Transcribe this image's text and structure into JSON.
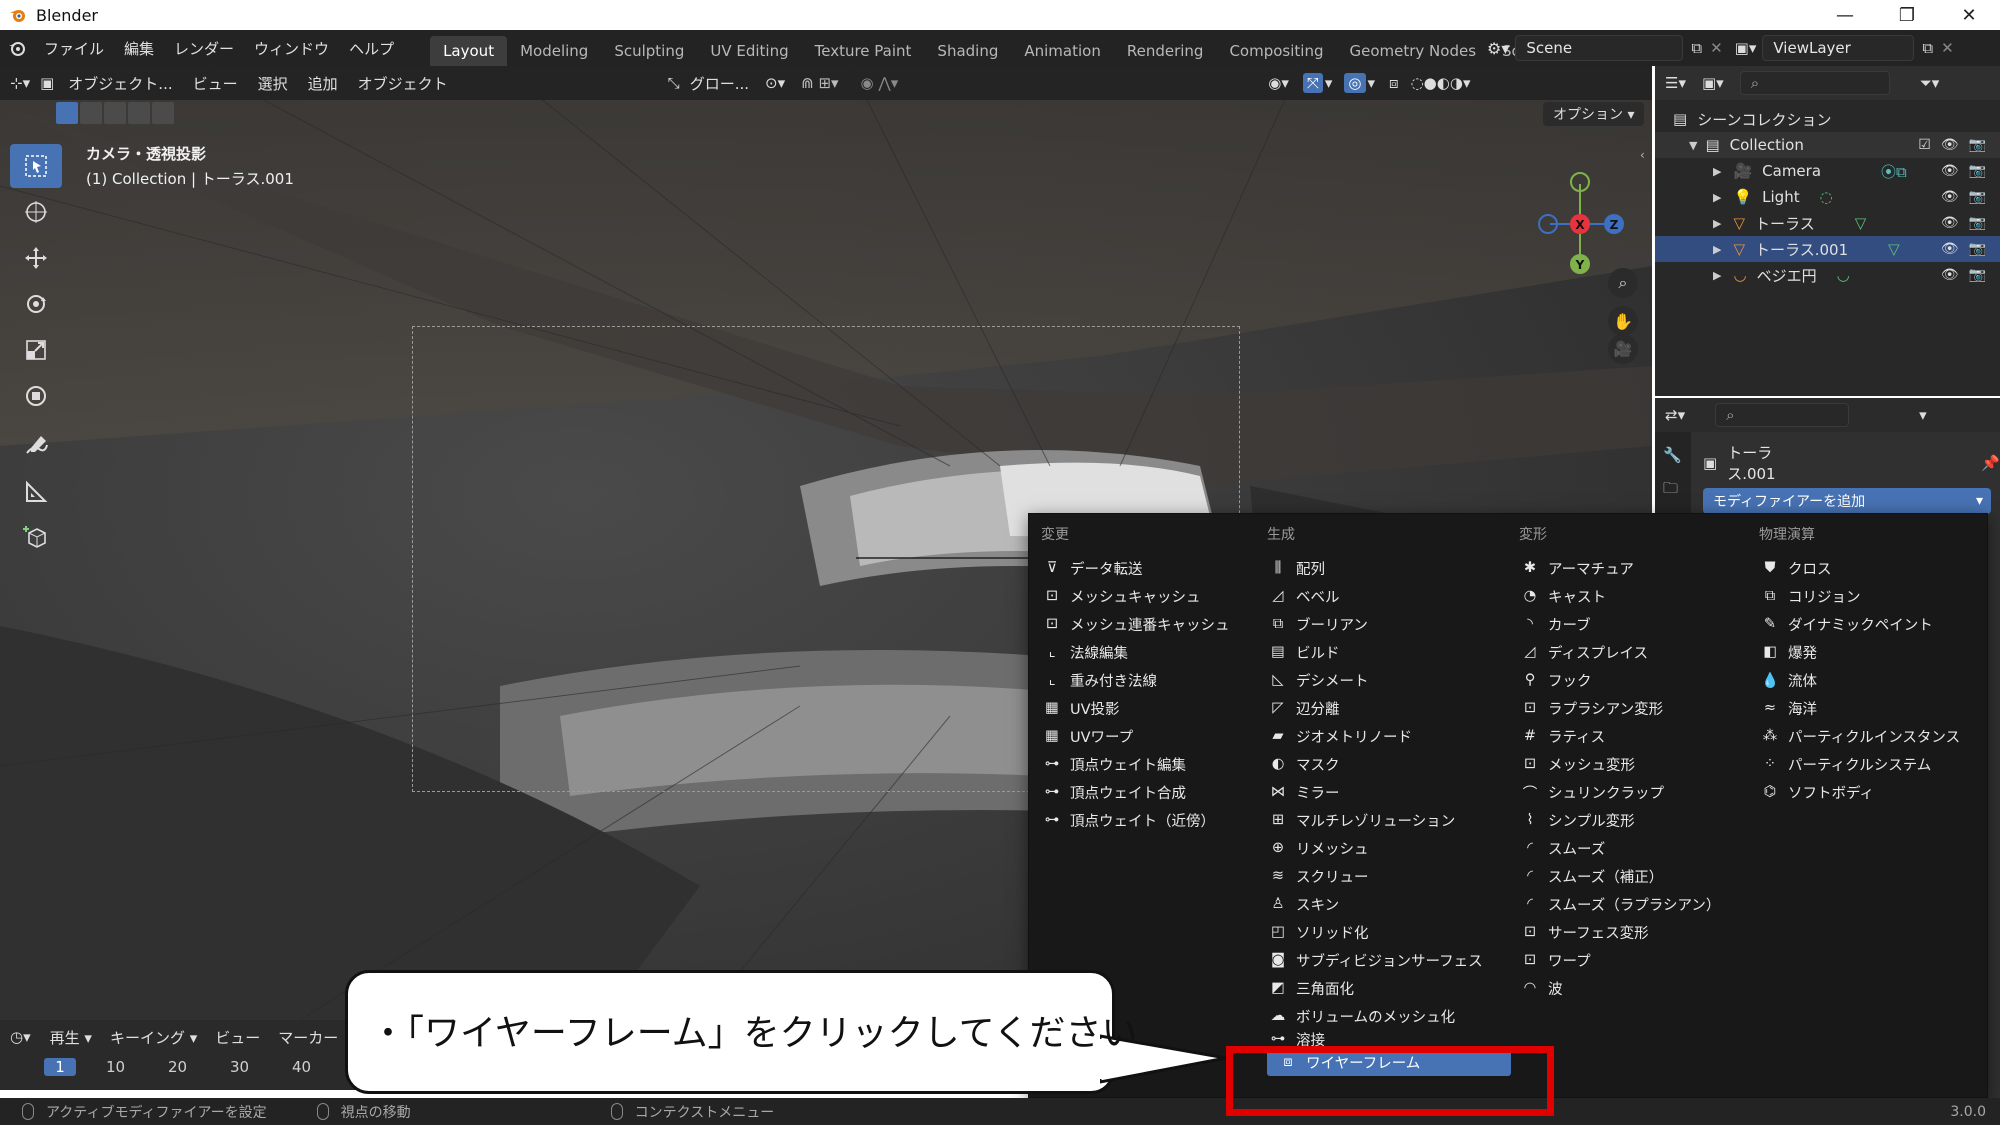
{
  "window": {
    "title": "Blender",
    "minimize": "—",
    "maximize": "❐",
    "close": "✕"
  },
  "menu": {
    "items": [
      "ファイル",
      "編集",
      "レンダー",
      "ウィンドウ",
      "ヘルプ"
    ]
  },
  "workspaces": {
    "tabs": [
      "Layout",
      "Modeling",
      "Sculpting",
      "UV Editing",
      "Texture Paint",
      "Shading",
      "Animation",
      "Rendering",
      "Compositing",
      "Geometry Nodes",
      "Scripting"
    ],
    "active": "Layout",
    "add": "+"
  },
  "scene": {
    "name": "Scene",
    "view_layer": "ViewLayer"
  },
  "viewport": {
    "header_items": [
      "オブジェクト...",
      "ビュー",
      "選択",
      "追加",
      "オブジェクト"
    ],
    "transform": "グロー...",
    "options": "オプション",
    "overlay_line1": "カメラ・透視投影",
    "overlay_line2": "(1) Collection | トーラス.001",
    "gizmo": {
      "x": "X",
      "y": "Y",
      "z": "Z"
    }
  },
  "timeline": {
    "header_items": [
      "再生",
      "キーイング",
      "ビュー",
      "マーカー"
    ],
    "frames": [
      "1",
      "10",
      "20",
      "30",
      "40"
    ],
    "current_frame": "1"
  },
  "statusbar": {
    "left": "アクティブモディファイアーを設定",
    "middle": "視点の移動",
    "right": "コンテクストメニュー",
    "version": "3.0.0"
  },
  "outliner": {
    "root": "シーンコレクション",
    "collection": "Collection",
    "objects": [
      "Camera",
      "Light",
      "トーラス",
      "トーラス.001",
      "ベジエ円"
    ]
  },
  "properties": {
    "object_name": "トーラス.001",
    "add_modifier": "モディファイアーを追加"
  },
  "modifier_menu": {
    "columns": [
      {
        "heading": "変更",
        "items": [
          "データ転送",
          "メッシュキャッシュ",
          "メッシュ連番キャッシュ",
          "法線編集",
          "重み付き法線",
          "UV投影",
          "UVワープ",
          "頂点ウェイト編集",
          "頂点ウェイト合成",
          "頂点ウェイト（近傍）"
        ]
      },
      {
        "heading": "生成",
        "items": [
          "配列",
          "ベベル",
          "ブーリアン",
          "ビルド",
          "デシメート",
          "辺分離",
          "ジオメトリノード",
          "マスク",
          "ミラー",
          "マルチレゾリューション",
          "リメッシュ",
          "スクリュー",
          "スキン",
          "ソリッド化",
          "サブディビジョンサーフェス",
          "三角面化",
          "ボリュームのメッシュ化",
          "溶接",
          "ワイヤーフレーム"
        ]
      },
      {
        "heading": "変形",
        "items": [
          "アーマチュア",
          "キャスト",
          "カーブ",
          "ディスプレイス",
          "フック",
          "ラプラシアン変形",
          "ラティス",
          "メッシュ変形",
          "シュリンクラップ",
          "シンプル変形",
          "スムーズ",
          "スムーズ（補正）",
          "スムーズ（ラプラシアン）",
          "サーフェス変形",
          "ワープ",
          "波"
        ]
      },
      {
        "heading": "物理演算",
        "items": [
          "クロス",
          "コリジョン",
          "ダイナミックペイント",
          "爆発",
          "流体",
          "海洋",
          "パーティクルインスタンス",
          "パーティクルシステム",
          "ソフトボディ"
        ]
      }
    ],
    "highlighted": "ワイヤーフレーム"
  },
  "callout": {
    "text": "・「ワイヤーフレーム」をクリックしてください"
  },
  "colors": {
    "accent": "#4772b3",
    "annotation_red": "#e00000"
  }
}
